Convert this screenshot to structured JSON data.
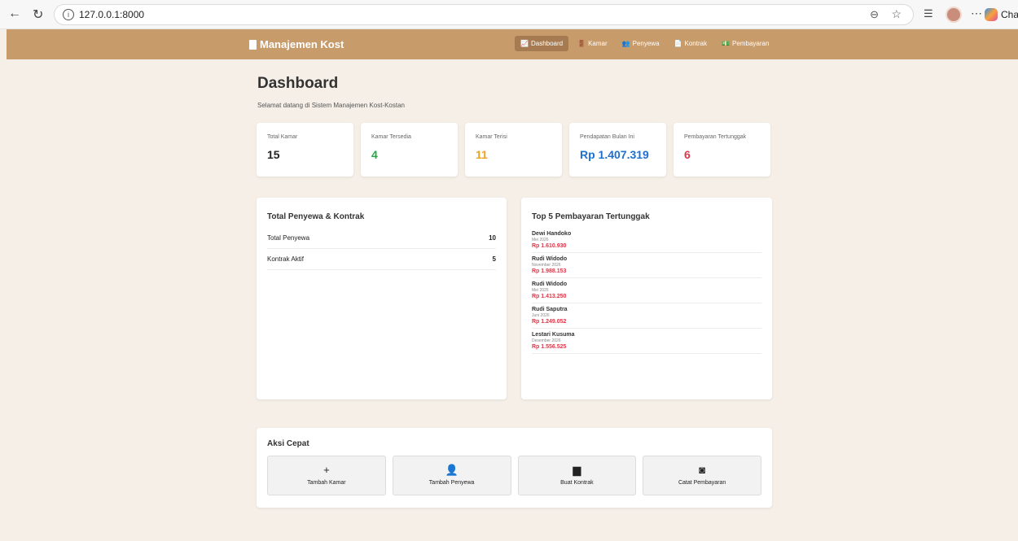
{
  "browser": {
    "url": "127.0.0.1:8000",
    "chat_label": "Chat"
  },
  "navbar": {
    "brand": "Manajemen Kost",
    "links": [
      {
        "label": "Dashboard",
        "icon": "chart-line-icon"
      },
      {
        "label": "Kamar",
        "icon": "door-icon"
      },
      {
        "label": "Penyewa",
        "icon": "users-icon"
      },
      {
        "label": "Kontrak",
        "icon": "file-icon"
      },
      {
        "label": "Pembayaran",
        "icon": "money-icon"
      }
    ]
  },
  "header": {
    "title": "Dashboard",
    "subtitle": "Selamat datang di Sistem Manajemen Kost-Kostan"
  },
  "stats": [
    {
      "label": "Total Kamar",
      "value": "15",
      "color": "#222222"
    },
    {
      "label": "Kamar Tersedia",
      "value": "4",
      "color": "#28a745"
    },
    {
      "label": "Kamar Terisi",
      "value": "11",
      "color": "#f0a020"
    },
    {
      "label": "Pendapatan Bulan Ini",
      "value": "Rp 1.407.319",
      "color": "#1f6fd1"
    },
    {
      "label": "Pembayaran Tertunggak",
      "value": "6",
      "color": "#d9394a"
    }
  ],
  "summary": {
    "title": "Total Penyewa & Kontrak",
    "rows": [
      {
        "label": "Total Penyewa",
        "value": "10"
      },
      {
        "label": "Kontrak Aktif",
        "value": "5"
      }
    ]
  },
  "overdue": {
    "title": "Top 5 Pembayaran Tertunggak",
    "items": [
      {
        "name": "Dewi Handoko",
        "month": "Mei 2026",
        "amount": "Rp 1.610.930"
      },
      {
        "name": "Rudi Widodo",
        "month": "November 2026",
        "amount": "Rp 1.988.153"
      },
      {
        "name": "Rudi Widodo",
        "month": "Mei 2025",
        "amount": "Rp 1.413.250"
      },
      {
        "name": "Rudi Saputra",
        "month": "Juni 2026",
        "amount": "Rp 1.249.052"
      },
      {
        "name": "Lestari Kusuma",
        "month": "Desember 2026",
        "amount": "Rp 1.556.525"
      }
    ]
  },
  "quick_actions": {
    "title": "Aksi Cepat",
    "items": [
      {
        "label": "Tambah Kamar",
        "icon": "plus-icon",
        "glyph": "+"
      },
      {
        "label": "Tambah Penyewa",
        "icon": "user-plus-icon",
        "glyph": "👤"
      },
      {
        "label": "Buat Kontrak",
        "icon": "file-contract-icon",
        "glyph": "▆"
      },
      {
        "label": "Catat Pembayaran",
        "icon": "money-bill-icon",
        "glyph": "◙"
      }
    ]
  }
}
